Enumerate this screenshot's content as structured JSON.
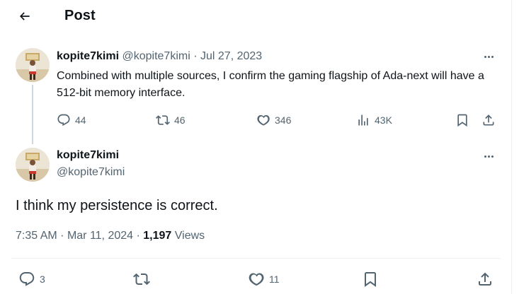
{
  "header": {
    "title": "Post"
  },
  "thread": {
    "parent": {
      "name": "kopite7kimi",
      "handle": "@kopite7kimi",
      "separator": "·",
      "date": "Jul 27, 2023",
      "text": "Combined with multiple sources, I confirm the gaming flagship of Ada-next will have a 512-bit memory interface.",
      "actions": {
        "replies": "44",
        "reposts": "46",
        "likes": "346",
        "views": "43K"
      }
    },
    "main": {
      "name": "kopite7kimi",
      "handle": "@kopite7kimi",
      "text": "I think my persistence is correct.",
      "time": "7:35 AM",
      "separator": "·",
      "date": "Mar 11, 2024",
      "views_count": "1,197",
      "views_label": "Views",
      "actions": {
        "replies": "3",
        "likes": "11"
      }
    }
  },
  "icons": {
    "back": "arrow-left-icon",
    "more": "ellipsis-icon",
    "reply": "speech-bubble-icon",
    "repost": "repost-arrows-icon",
    "like": "heart-icon",
    "views": "bar-chart-icon",
    "bookmark": "bookmark-icon",
    "share": "share-upload-icon"
  },
  "colors": {
    "text": "#0f1419",
    "muted": "#536471",
    "line": "#cfd9de"
  }
}
